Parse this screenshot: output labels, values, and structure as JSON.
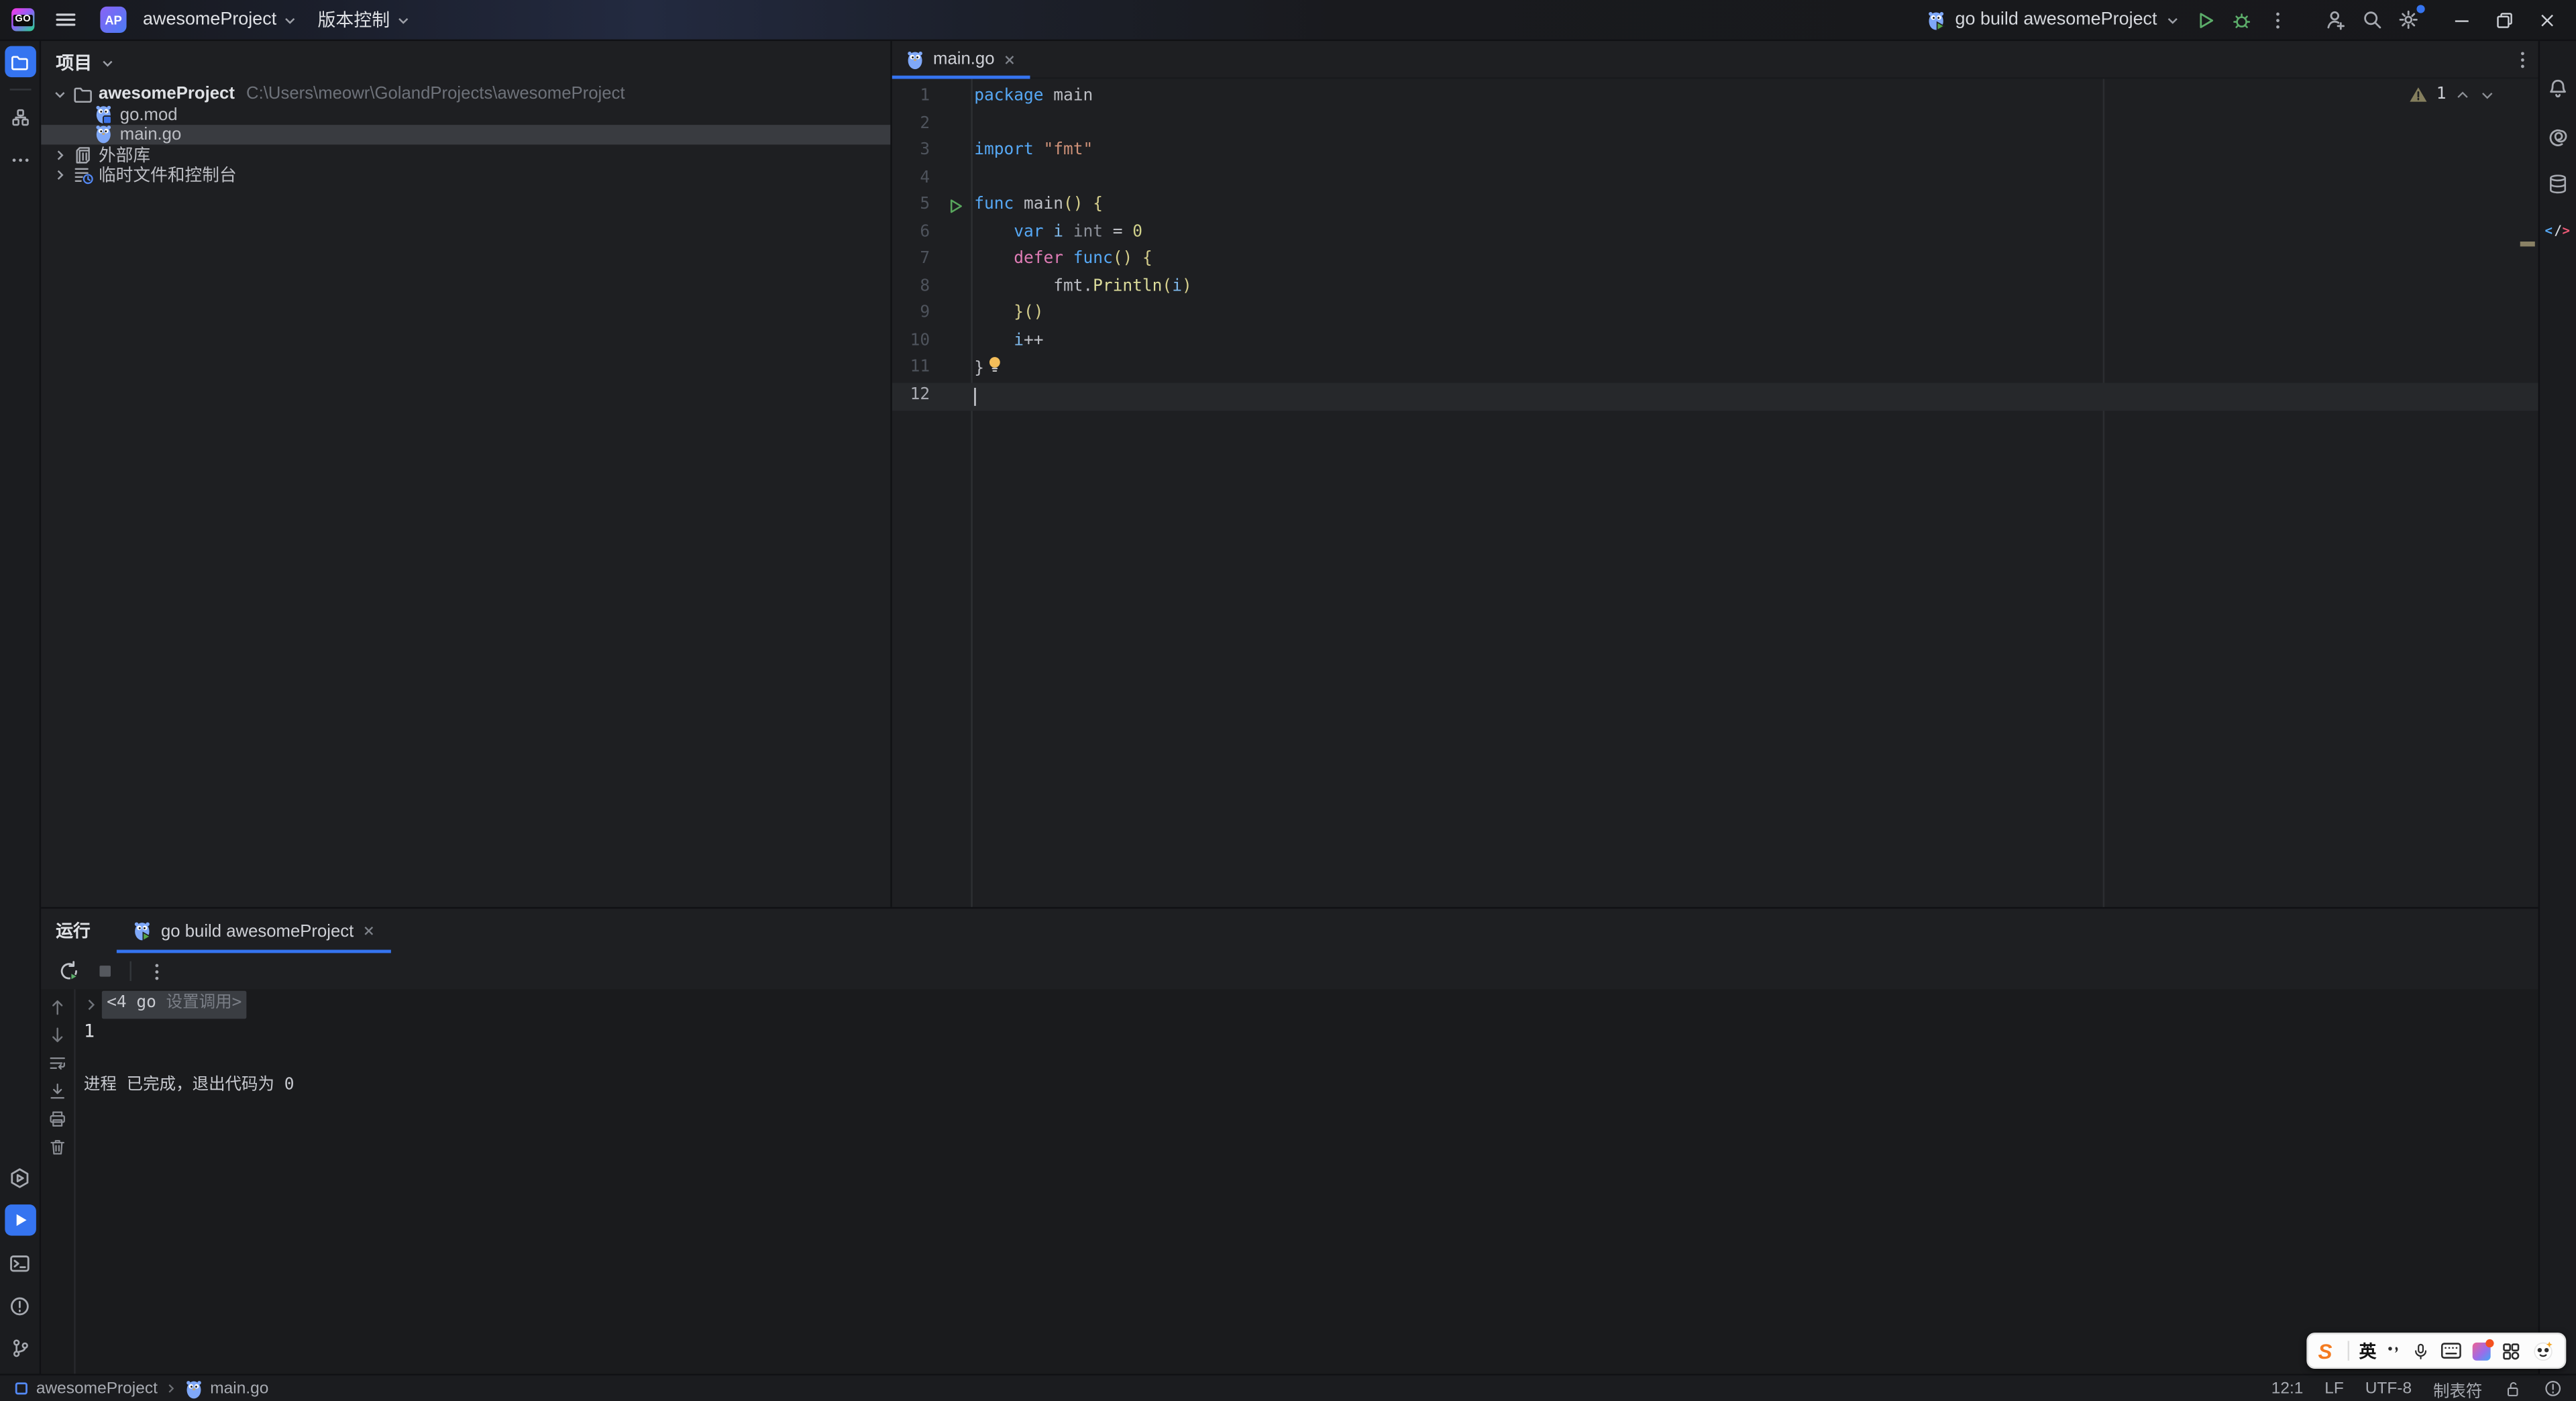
{
  "titlebar": {
    "logo_text": "GO",
    "avatar_text": "AP",
    "project_name": "awesomeProject",
    "vcs_menu": "版本控制",
    "run_config": "go build awesomeProject"
  },
  "project_panel": {
    "header": "项目",
    "tree": [
      {
        "label": "awesomeProject",
        "path": "C:\\Users\\meowr\\GolandProjects\\awesomeProject",
        "icon": "folder",
        "chevron": "down",
        "bold": true,
        "level": 0,
        "selected": false
      },
      {
        "label": "go.mod",
        "icon": "gomod",
        "chevron": "none",
        "bold": false,
        "level": 1,
        "selected": false
      },
      {
        "label": "main.go",
        "icon": "gofile",
        "chevron": "none",
        "bold": false,
        "level": 1,
        "selected": true
      },
      {
        "label": "外部库",
        "icon": "library",
        "chevron": "right",
        "bold": false,
        "level": 0,
        "selected": false
      },
      {
        "label": "临时文件和控制台",
        "icon": "scratch",
        "chevron": "right",
        "bold": false,
        "level": 0,
        "selected": false
      }
    ]
  },
  "editor": {
    "tab": "main.go",
    "warning_count": "1",
    "lines": [
      {
        "n": "1",
        "tokens": [
          [
            "kw",
            "package"
          ],
          [
            "pl",
            " main"
          ]
        ]
      },
      {
        "n": "2",
        "tokens": []
      },
      {
        "n": "3",
        "tokens": [
          [
            "kw",
            "import"
          ],
          [
            "pl",
            " "
          ],
          [
            "str",
            "\"fmt\""
          ]
        ]
      },
      {
        "n": "4",
        "tokens": []
      },
      {
        "n": "5",
        "run": true,
        "tokens": [
          [
            "kw",
            "func"
          ],
          [
            "pl",
            " main"
          ],
          [
            "br",
            "()"
          ],
          [
            "pl",
            " "
          ],
          [
            "br",
            "{"
          ]
        ]
      },
      {
        "n": "6",
        "tokens": [
          [
            "pl",
            "    "
          ],
          [
            "kw",
            "var"
          ],
          [
            "pl",
            " "
          ],
          [
            "id",
            "i"
          ],
          [
            "pl",
            " "
          ],
          [
            "ty",
            "int"
          ],
          [
            "pl",
            " = "
          ],
          [
            "num",
            "0"
          ]
        ]
      },
      {
        "n": "7",
        "tokens": [
          [
            "pl",
            "    "
          ],
          [
            "df",
            "defer"
          ],
          [
            "pl",
            " "
          ],
          [
            "kw",
            "func"
          ],
          [
            "br",
            "()"
          ],
          [
            "pl",
            " "
          ],
          [
            "br",
            "{"
          ]
        ]
      },
      {
        "n": "8",
        "tokens": [
          [
            "pl",
            "        fmt."
          ],
          [
            "fn",
            "Println"
          ],
          [
            "br",
            "("
          ],
          [
            "id",
            "i"
          ],
          [
            "br",
            ")"
          ]
        ]
      },
      {
        "n": "9",
        "tokens": [
          [
            "pl",
            "    "
          ],
          [
            "br",
            "}()"
          ]
        ]
      },
      {
        "n": "10",
        "tokens": [
          [
            "pl",
            "    "
          ],
          [
            "id",
            "i"
          ],
          [
            "pl",
            "++"
          ]
        ]
      },
      {
        "n": "11",
        "bulb": true,
        "tokens": [
          [
            "pl",
            "}"
          ]
        ]
      },
      {
        "n": "12",
        "caret": true,
        "tokens": []
      }
    ]
  },
  "run_panel": {
    "title": "运行",
    "tab": "go build awesomeProject",
    "console": {
      "fold_bright": "<4 go ",
      "fold_dim": "设置调用>",
      "output": "1",
      "exit_line": "进程 已完成，退出代码为 0"
    }
  },
  "status_bar": {
    "project": "awesomeProject",
    "file": "main.go",
    "caret": "12:1",
    "line_ending": "LF",
    "encoding": "UTF-8",
    "indent": "制表符"
  },
  "ime": {
    "lang": "英"
  },
  "colors": {
    "accent": "#3574F0",
    "keyword": "#56A8F5",
    "keyword_defer": "#E07CB6",
    "string": "#CE9178",
    "function": "#DCDC9B",
    "number": "#CFD08A",
    "type": "#8C9099",
    "identifier": "#7EB8EA",
    "run_green": "#5CAD6A",
    "warning": "#857F5E",
    "editor_bg": "#1E1F22",
    "console_bg": "#1A1B1D",
    "selection_row": "#393B40",
    "caret_line": "#26282B"
  }
}
